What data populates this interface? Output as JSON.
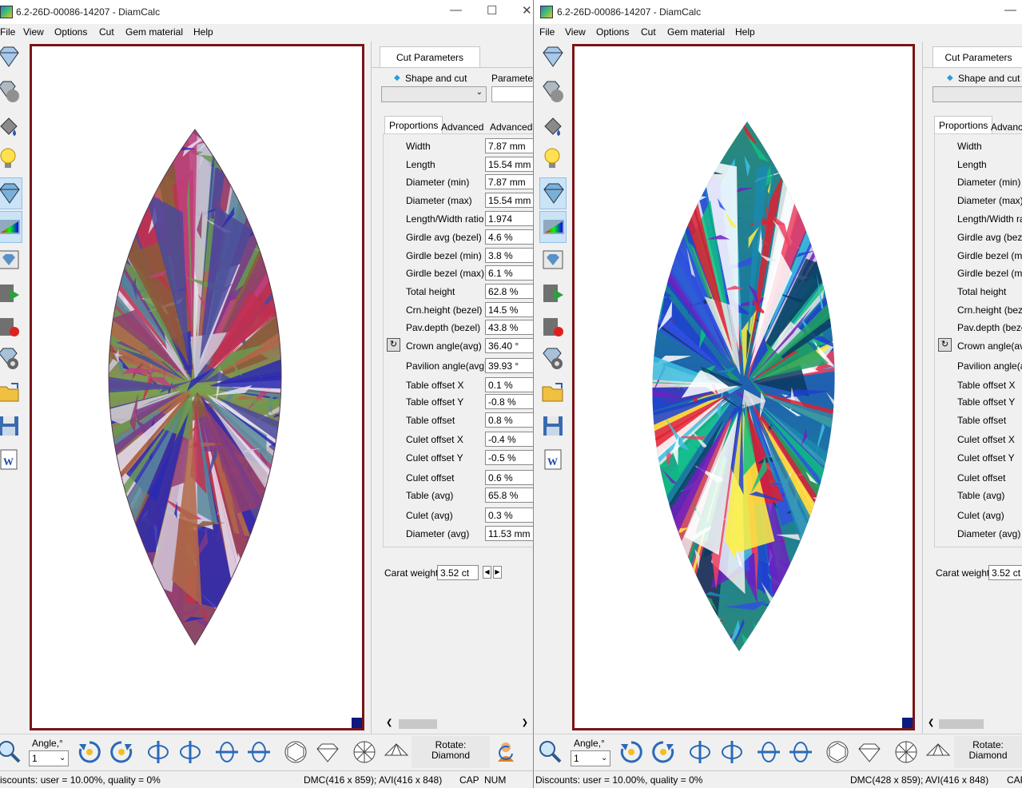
{
  "app": {
    "window_title": "6.2-26D-00086-14207 - DiamCalc",
    "menu": [
      "File",
      "View",
      "Options",
      "Cut",
      "Gem material",
      "Help"
    ]
  },
  "left": {
    "panel_tab": "Cut Parameters",
    "shape_label": "Shape and cut",
    "parameters_label": "Parameters",
    "tabs": [
      "Proportions",
      "Advanced",
      "Advanced ..."
    ],
    "params": [
      {
        "label": "Width",
        "value": "7.87 mm"
      },
      {
        "label": "Length",
        "value": "15.54 mm"
      },
      {
        "label": "Diameter (min)",
        "value": "7.87 mm"
      },
      {
        "label": "Diameter (max)",
        "value": "15.54 mm"
      },
      {
        "label": "Length/Width ratio",
        "value": "1.974"
      },
      {
        "label": "Girdle avg (bezel)",
        "value": "4.6 %"
      },
      {
        "label": "Girdle bezel (min)",
        "value": "3.8 %"
      },
      {
        "label": "Girdle bezel (max)",
        "value": "6.1 %"
      },
      {
        "label": "Total height",
        "value": "62.8 %"
      },
      {
        "label": "Crn.height (bezel)",
        "value": "14.5 %"
      },
      {
        "label": "Pav.depth (bezel)",
        "value": "43.8 %"
      },
      {
        "label": "Crown angle(avg)",
        "value": "36.40 °"
      },
      {
        "label": "Pavilion angle(avg)",
        "value": "39.93 °"
      },
      {
        "label": "Table offset X",
        "value": "0.1 %"
      },
      {
        "label": "Table offset Y",
        "value": "-0.8 %"
      },
      {
        "label": "Table offset",
        "value": "0.8 %"
      },
      {
        "label": "Culet offset X",
        "value": "-0.4 %"
      },
      {
        "label": "Culet offset Y",
        "value": "-0.5 %"
      },
      {
        "label": "Culet offset",
        "value": "0.6 %"
      },
      {
        "label": "Table (avg)",
        "value": "65.8 %"
      },
      {
        "label": "Culet (avg)",
        "value": "0.3 %"
      },
      {
        "label": "Diameter (avg)",
        "value": "11.53 mm"
      }
    ],
    "carat_label": "Carat weight",
    "carat_value": "3.52 ct",
    "angle_label": "Angle,°",
    "angle_value": "1",
    "rotate_label": "Rotate:",
    "rotate_value": "Diamond",
    "status_discount": "iscounts: user = 10.00%, quality = 0%",
    "status_dmc": "DMC(416 x 859); AVI(416 x 848)",
    "status_cap": "CAP",
    "status_num": "NUM"
  },
  "right": {
    "panel_tab": "Cut Parameters",
    "shape_label": "Shape and cut",
    "tabs": [
      "Proportions",
      "Advance"
    ],
    "params": [
      {
        "label": "Width"
      },
      {
        "label": "Length"
      },
      {
        "label": "Diameter (min)"
      },
      {
        "label": "Diameter (max)"
      },
      {
        "label": "Length/Width rat"
      },
      {
        "label": "Girdle avg (bezel"
      },
      {
        "label": "Girdle bezel (min)"
      },
      {
        "label": "Girdle bezel (max"
      },
      {
        "label": "Total height"
      },
      {
        "label": "Crn.height (bezel"
      },
      {
        "label": "Pav.depth (bezel"
      },
      {
        "label": "Crown angle(avg"
      },
      {
        "label": "Pavilion angle(av"
      },
      {
        "label": "Table offset X"
      },
      {
        "label": "Table offset Y"
      },
      {
        "label": "Table offset"
      },
      {
        "label": "Culet offset X"
      },
      {
        "label": "Culet offset Y"
      },
      {
        "label": "Culet offset"
      },
      {
        "label": "Table (avg)"
      },
      {
        "label": "Culet (avg)"
      },
      {
        "label": "Diameter (avg)"
      }
    ],
    "carat_label": "Carat weight",
    "carat_value": "3.52 ct",
    "angle_label": "Angle,°",
    "angle_value": "1",
    "rotate_label": "Rotate:",
    "rotate_value": "Diamond",
    "status_discount": "Discounts: user = 10.00%, quality = 0%",
    "status_dmc": "DMC(428 x 859); AVI(416 x 848)",
    "status_cap": "CAP"
  },
  "icons": {
    "toolbar": [
      "diamond-view-icon",
      "diamond-ball-icon",
      "paint-bucket-icon",
      "light-bulb-icon",
      "diamond-render-icon",
      "spectrum-icon",
      "picture-icon",
      "video-play-icon",
      "video-record-icon",
      "diamond-gear-icon",
      "open-folder-icon",
      "save-disk-icon",
      "word-export-icon"
    ],
    "bottom": [
      "zoom-icon",
      "rotate-cw-icon",
      "rotate-ccw-icon",
      "flip-v-icon",
      "flip-v2-icon",
      "flip-h-icon",
      "flip-h2-icon",
      "round-top-icon",
      "round-side-icon",
      "round-bottom-icon",
      "round-pavilion-icon"
    ]
  },
  "colors": {
    "viewer_border": "#7a1416",
    "accent": "#0a1a80"
  }
}
